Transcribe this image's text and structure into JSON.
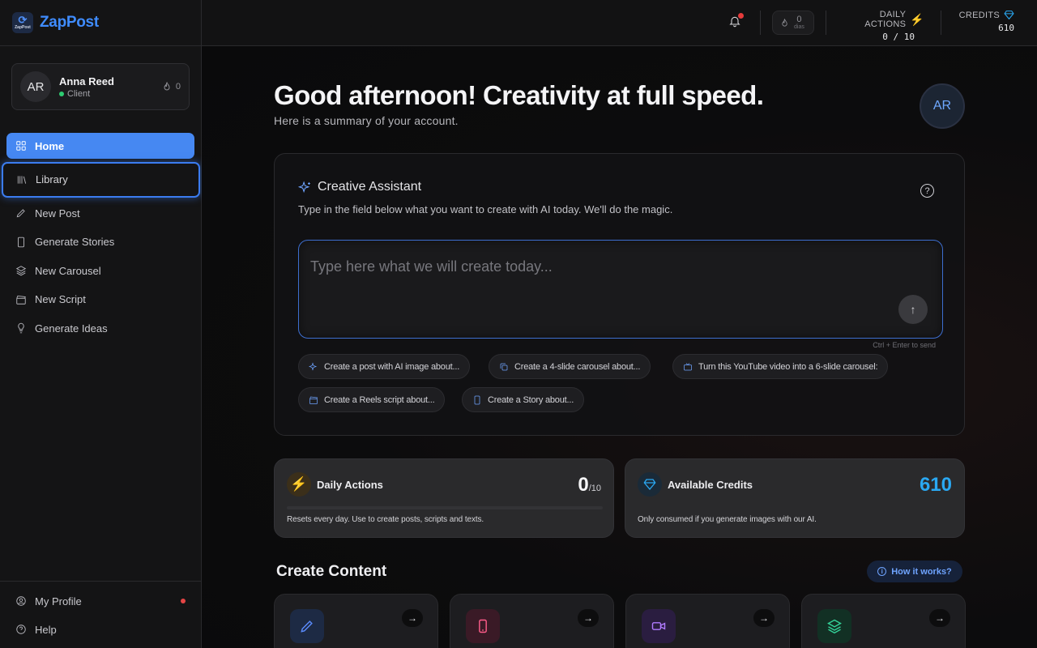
{
  "brand": {
    "name": "ZapPost",
    "logo_text": "ZapPost"
  },
  "user": {
    "initials": "AR",
    "name": "Anna Reed",
    "role": "Client",
    "streak": "0"
  },
  "nav": {
    "items": [
      {
        "label": "Home",
        "icon": "grid-icon"
      },
      {
        "label": "Library",
        "icon": "library-icon"
      },
      {
        "label": "New Post",
        "icon": "pencil-icon"
      },
      {
        "label": "Generate Stories",
        "icon": "phone-icon"
      },
      {
        "label": "New Carousel",
        "icon": "layers-icon"
      },
      {
        "label": "New Script",
        "icon": "clapper-icon"
      },
      {
        "label": "Generate Ideas",
        "icon": "bulb-icon"
      }
    ],
    "bottom": [
      {
        "label": "My Profile",
        "icon": "user-circle-icon"
      },
      {
        "label": "Help",
        "icon": "help-icon"
      }
    ]
  },
  "topbar": {
    "days_value": "0",
    "days_label": "dias",
    "daily_actions_label": "DAILY ACTIONS",
    "daily_actions_value": "0 / 10",
    "credits_label": "CREDITS",
    "credits_value": "610"
  },
  "greeting": {
    "title": "Good afternoon! Creativity at full speed.",
    "subtitle": "Here is a summary of your account.",
    "avatar": "AR"
  },
  "assistant": {
    "title": "Creative Assistant",
    "subtitle": "Type in the field below what you want to create with AI today. We'll do the magic.",
    "placeholder": "Type here what we will create today...",
    "hint": "Ctrl + Enter to send",
    "chips": [
      "Create a post with AI image about...",
      "Create a 4-slide carousel about...",
      "Turn this YouTube video into a 6-slide carousel:",
      "Create a Reels script about...",
      "Create a Story about..."
    ]
  },
  "stats": {
    "daily": {
      "title": "Daily Actions",
      "value": "0",
      "max": "/10",
      "desc": "Resets every day. Use to create posts, scripts and texts.",
      "progress": 0
    },
    "credits": {
      "title": "Available Credits",
      "value": "610",
      "desc": "Only consumed if you generate images with our AI."
    }
  },
  "create": {
    "title": "Create Content",
    "how_label": "How it works?",
    "cards": [
      {
        "icon": "pencil-icon",
        "color": "#5b8cff"
      },
      {
        "icon": "phone-icon",
        "color": "#ff5c8a"
      },
      {
        "icon": "video-icon",
        "color": "#b07bff"
      },
      {
        "icon": "layers-icon",
        "color": "#34d399"
      }
    ]
  },
  "colors": {
    "accent": "#4688f2",
    "credits": "#2aa8f2",
    "lightning": "#f5b321"
  }
}
